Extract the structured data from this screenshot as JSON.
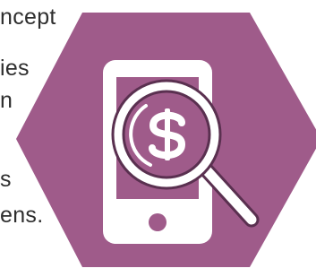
{
  "text_fragments": [
    "ncept",
    "ies",
    "n",
    "s",
    "ens."
  ],
  "illustration": {
    "icons": [
      "hexagon-badge",
      "smartphone-icon",
      "magnifying-glass-icon",
      "dollar-sign-icon"
    ],
    "colors": {
      "hexagon": "#9f5b8a",
      "phone_body": "#ffffff",
      "phone_screen": "#9f5b8a",
      "magnifier": "#ffffff",
      "dollar": "#ffffff"
    }
  }
}
